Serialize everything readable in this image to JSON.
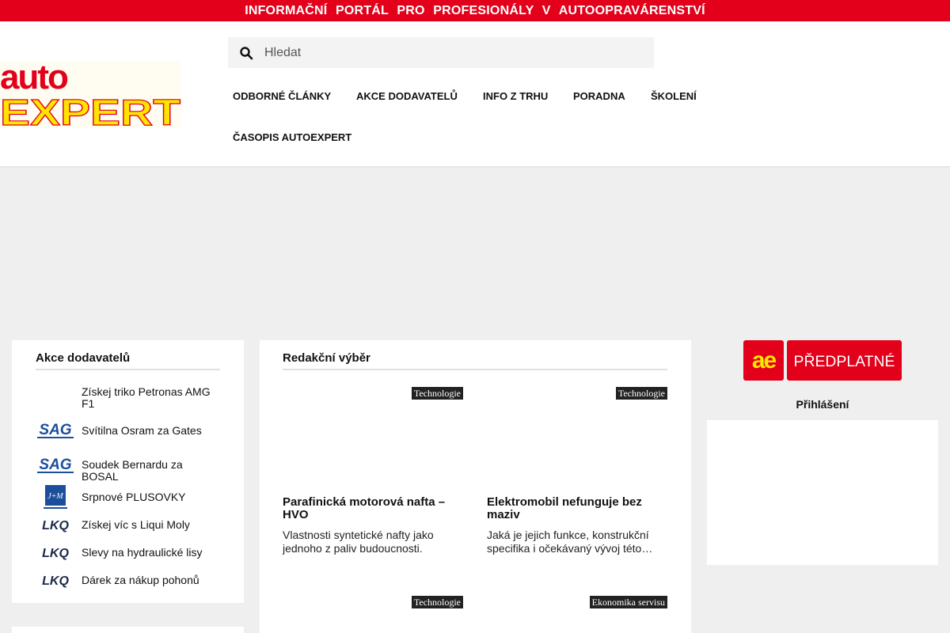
{
  "topbar": {
    "text": "INFORMAČNÍ PORTÁL PRO PROFESIONÁLY V AUTOOPRAVÁRENSTVÍ"
  },
  "logo": {
    "line1": "auto",
    "line2": "EXPERT",
    "colors": {
      "red": "#e2001a",
      "yellow": "#ffe500"
    }
  },
  "search": {
    "placeholder": "Hledat",
    "value": ""
  },
  "nav": {
    "items": [
      {
        "label": "Odborné články"
      },
      {
        "label": "Akce dodavatelů"
      },
      {
        "label": "Info z trhu"
      },
      {
        "label": "Poradna"
      },
      {
        "label": "Školení"
      },
      {
        "label": "Časopis AutoExpert"
      }
    ]
  },
  "akce": {
    "title": "Akce dodavatelů",
    "items": [
      {
        "label": "Získej triko Petronas AMG F1",
        "logo": ""
      },
      {
        "label": "Svítilna Osram za Gates",
        "logo": "SAG"
      },
      {
        "label": "Soudek Bernardu za BOSAL",
        "logo": "SAG"
      },
      {
        "label": "Srpnové PLUSOVKY",
        "logo": "J+M"
      },
      {
        "label": "Získej víc s Liqui Moly",
        "logo": "LKQ"
      },
      {
        "label": "Slevy na hydraulické lisy",
        "logo": "LKQ"
      },
      {
        "label": "Dárek za nákup pohonů",
        "logo": "LKQ"
      }
    ]
  },
  "redakce": {
    "title": "Redakční výběr",
    "articles": [
      {
        "category": "Technologie",
        "title": "Parafinická motorová nafta – HVO",
        "excerpt": "Vlastnosti syntetické nafty jako jednoho z paliv budoucnosti."
      },
      {
        "category": "Technologie",
        "title": "Elektromobil nefunguje bez maziv",
        "excerpt": "Jaká je jejich funkce, konstrukční specifika i očekávaný vývoj této…"
      },
      {
        "category": "Technologie",
        "title": "",
        "excerpt": ""
      },
      {
        "category": "Ekonomika servisu",
        "title": "",
        "excerpt": ""
      }
    ]
  },
  "sidebar": {
    "subscribe": {
      "short": "ae",
      "label": "PŘEDPLATNÉ",
      "color": "#e2001a"
    },
    "login_label": "Přihlášení"
  }
}
